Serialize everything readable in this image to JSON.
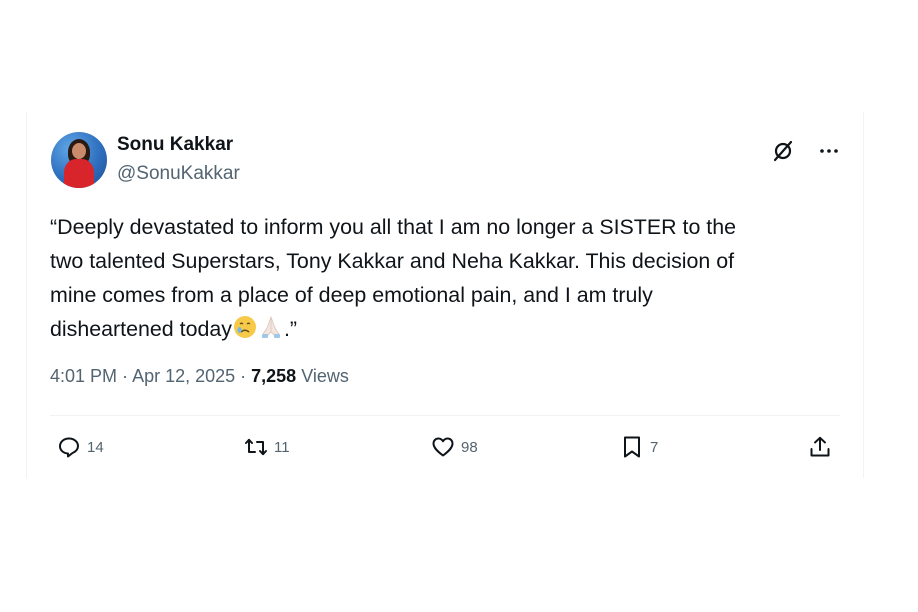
{
  "tweet": {
    "author_name": "Sonu Kakkar",
    "author_handle": "@SonuKakkar",
    "text_line1": "“Deeply devastated to inform you all that I am no longer a SISTER to the",
    "text_line2": "two talented Superstars, Tony Kakkar and Neha Kakkar. This decision of",
    "text_line3": "mine comes from a place of deep emotional pain, and I am truly",
    "text_line4_start": "disheartened today",
    "text_line4_end": ".”",
    "time": "4:01 PM",
    "separator": " · ",
    "date": "Apr 12, 2025",
    "views_count": "7,258",
    "views_label": " Views"
  },
  "actions": {
    "reply_count": "14",
    "retweet_count": "11",
    "like_count": "98",
    "bookmark_count": "7"
  },
  "icons": [
    "grok-icon",
    "more-icon",
    "crying-face-emoji",
    "folded-hands-emoji",
    "reply-icon",
    "retweet-icon",
    "heart-icon",
    "bookmark-icon",
    "share-icon"
  ],
  "colors": {
    "text": "#0f1419",
    "secondary": "#536471",
    "divider": "#eff3f4"
  }
}
